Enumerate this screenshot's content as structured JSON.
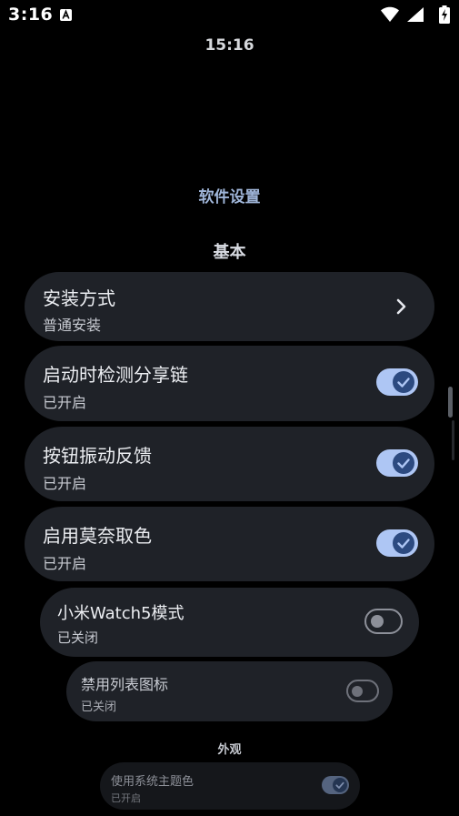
{
  "status_bar": {
    "time": "3:16",
    "icons": [
      "a-notification-icon",
      "wifi-icon",
      "signal-icon",
      "battery-charging-icon"
    ]
  },
  "clock": "15:16",
  "page_title": "软件设置",
  "sections": {
    "basic": "基本",
    "appearance": "外观"
  },
  "settings": {
    "install_method": {
      "title": "安装方式",
      "subtitle": "普通安装"
    },
    "detect_share_link": {
      "title": "启动时检测分享链",
      "subtitle": "已开启",
      "enabled": true
    },
    "button_vibration": {
      "title": "按钮振动反馈",
      "subtitle": "已开启",
      "enabled": true
    },
    "monet_color": {
      "title": "启用莫奈取色",
      "subtitle": "已开启",
      "enabled": true
    },
    "mi_watch5_mode": {
      "title": "小米Watch5模式",
      "subtitle": "已关闭",
      "enabled": false
    },
    "disable_list_icons": {
      "title": "禁用列表图标",
      "subtitle": "已关闭",
      "enabled": false
    },
    "system_theme_color": {
      "title": "使用系统主题色",
      "subtitle": "已开启",
      "enabled": true
    }
  },
  "colors": {
    "background": "#000000",
    "card": "#1f2228",
    "toggle_on_track": "#aec6f4",
    "toggle_on_knob": "#2c4a80",
    "title_accent": "#9fb5d8"
  }
}
